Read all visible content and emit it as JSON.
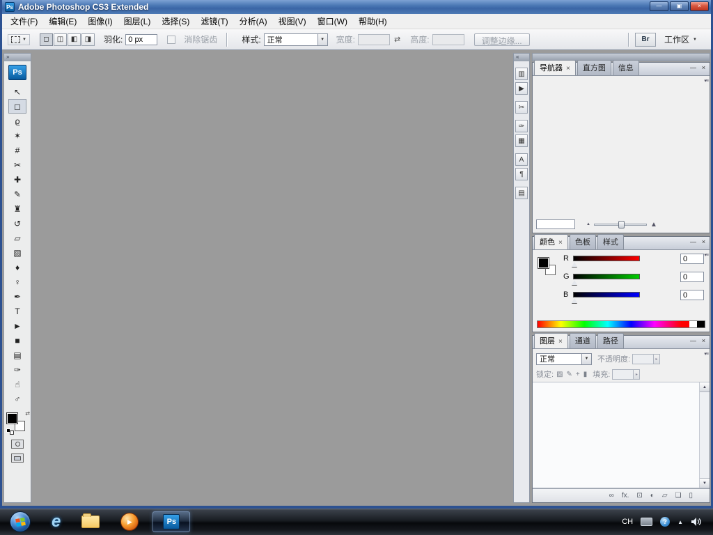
{
  "icons": {
    "min": "—",
    "restore": "▣",
    "close": "×",
    "dropdown": "▼",
    "spinner": "▸",
    "collapse_right": "»",
    "collapse_left": "«",
    "swap": "⇄",
    "tab_close": "×",
    "panel_min": "—",
    "panel_close": "×",
    "panel_menu": "▾≡",
    "scroll_up": "▲",
    "scroll_down": "▼",
    "zoom_out_small": "▲",
    "zoom_in_large": "▲",
    "play": "▶",
    "tray_up": "▲"
  },
  "titlebar": {
    "app": "Ps",
    "title": "Adobe Photoshop CS3 Extended"
  },
  "menubar": {
    "items": [
      "文件(F)",
      "编辑(E)",
      "图像(I)",
      "图层(L)",
      "选择(S)",
      "滤镜(T)",
      "分析(A)",
      "视图(V)",
      "窗口(W)",
      "帮助(H)"
    ]
  },
  "options": {
    "modes": [
      {
        "name": "new-selection-button",
        "glyph": "◻"
      },
      {
        "name": "add-to-selection-button",
        "glyph": "◫"
      },
      {
        "name": "subtract-from-selection-button",
        "glyph": "◧"
      },
      {
        "name": "intersect-selection-button",
        "glyph": "◨"
      }
    ],
    "feather_label": "羽化:",
    "feather_value": "0 px",
    "antialias_label": "消除锯齿",
    "style_label": "样式:",
    "style_value": "正常",
    "width_label": "宽度:",
    "height_label": "高度:",
    "refine_edge": "调整边缘...",
    "bridge": "Br",
    "workspace": "工作区"
  },
  "toolbox": {
    "logo": "Ps",
    "tools": [
      {
        "name": "move-tool",
        "glyph": "↖"
      },
      {
        "name": "rectangular-marquee-tool",
        "glyph": "◻",
        "active": true
      },
      {
        "name": "lasso-tool",
        "glyph": "ϱ"
      },
      {
        "name": "quick-selection-tool",
        "glyph": "✶"
      },
      {
        "name": "crop-tool",
        "glyph": "#"
      },
      {
        "name": "slice-tool",
        "glyph": "✂"
      },
      {
        "name": "spot-healing-brush-tool",
        "glyph": "✚"
      },
      {
        "name": "brush-tool",
        "glyph": "✎"
      },
      {
        "name": "clone-stamp-tool",
        "glyph": "♜"
      },
      {
        "name": "history-brush-tool",
        "glyph": "↺"
      },
      {
        "name": "eraser-tool",
        "glyph": "▱"
      },
      {
        "name": "gradient-tool",
        "glyph": "▧"
      },
      {
        "name": "blur-tool",
        "glyph": "♦"
      },
      {
        "name": "dodge-tool",
        "glyph": "♀"
      },
      {
        "name": "pen-tool",
        "glyph": "✒"
      },
      {
        "name": "horizontal-type-tool",
        "glyph": "T"
      },
      {
        "name": "path-selection-tool",
        "glyph": "►"
      },
      {
        "name": "rectangle-tool",
        "glyph": "■"
      },
      {
        "name": "notes-tool",
        "glyph": "▤"
      },
      {
        "name": "eyedropper-tool",
        "glyph": "✑"
      },
      {
        "name": "hand-tool",
        "glyph": "☝"
      },
      {
        "name": "zoom-tool",
        "glyph": "♂"
      }
    ],
    "foreground_color": "#000000",
    "background_color": "#ffffff"
  },
  "icon_dock": {
    "groups": [
      [
        {
          "name": "history-panel-button",
          "glyph": "▥"
        },
        {
          "name": "actions-panel-button",
          "glyph": "▶"
        }
      ],
      [
        {
          "name": "tool-presets-panel-button",
          "glyph": "✂"
        }
      ],
      [
        {
          "name": "brushes-panel-button",
          "glyph": "✑"
        },
        {
          "name": "clone-source-panel-button",
          "glyph": "▦"
        }
      ],
      [
        {
          "name": "character-panel-button",
          "glyph": "A"
        },
        {
          "name": "paragraph-panel-button",
          "glyph": "¶"
        }
      ],
      [
        {
          "name": "layer-comps-panel-button",
          "glyph": "▤"
        }
      ]
    ]
  },
  "panels": {
    "navigator": {
      "tabs": [
        {
          "name": "tab-navigator",
          "label": "导航器",
          "active": true
        },
        {
          "name": "tab-histogram",
          "label": "直方图"
        },
        {
          "name": "tab-info",
          "label": "信息"
        }
      ],
      "zoom_value": ""
    },
    "color": {
      "tabs": [
        {
          "name": "tab-color",
          "label": "颜色",
          "active": true
        },
        {
          "name": "tab-swatches",
          "label": "色板"
        },
        {
          "name": "tab-styles",
          "label": "样式"
        }
      ],
      "channels": [
        {
          "label": "R",
          "value": "0",
          "css": "grad-r"
        },
        {
          "label": "G",
          "value": "0",
          "css": "grad-g"
        },
        {
          "label": "B",
          "value": "0",
          "css": "grad-b"
        }
      ],
      "foreground_color": "#000000",
      "background_color": "#ffffff"
    },
    "layers": {
      "tabs": [
        {
          "name": "tab-layers",
          "label": "图层",
          "active": true
        },
        {
          "name": "tab-channels",
          "label": "通道"
        },
        {
          "name": "tab-paths",
          "label": "路径"
        }
      ],
      "blend_mode": "正常",
      "opacity_label": "不透明度:",
      "lock_label": "锁定:",
      "fill_label": "填充:",
      "locks": [
        {
          "name": "lock-transparency-icon",
          "glyph": "▨"
        },
        {
          "name": "lock-image-icon",
          "glyph": "✎"
        },
        {
          "name": "lock-position-icon",
          "glyph": "+"
        },
        {
          "name": "lock-all-icon",
          "glyph": "▮"
        }
      ],
      "actions": [
        {
          "name": "link-layers-button",
          "glyph": "∞"
        },
        {
          "name": "layer-style-button",
          "glyph": "fx."
        },
        {
          "name": "add-layer-mask-button",
          "glyph": "⊡"
        },
        {
          "name": "adjustment-layer-button",
          "glyph": "◐"
        },
        {
          "name": "new-group-button",
          "glyph": "▱"
        },
        {
          "name": "new-layer-button",
          "glyph": "❏"
        },
        {
          "name": "delete-layer-button",
          "glyph": "▯"
        }
      ]
    }
  },
  "taskbar": {
    "app": "Ps",
    "ie_glyph": "e",
    "lang": "CH",
    "help_glyph": "?"
  }
}
